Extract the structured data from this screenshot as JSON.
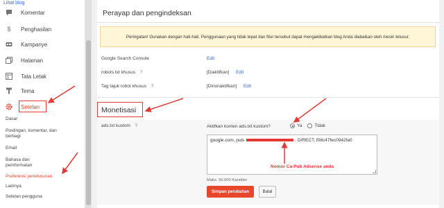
{
  "topbar": {
    "view_blog": "Lihat blog"
  },
  "sidebar": {
    "items": [
      {
        "label": "Komentar",
        "icon": "comment-icon"
      },
      {
        "label": "Penghasilan",
        "icon": "dollar-icon"
      },
      {
        "label": "Kampanye",
        "icon": "ad-icon"
      },
      {
        "label": "Halaman",
        "icon": "pages-icon"
      },
      {
        "label": "Tata Letak",
        "icon": "layout-icon"
      },
      {
        "label": "Tema",
        "icon": "brush-icon"
      },
      {
        "label": "Setelan",
        "icon": "gear-icon",
        "active": true
      }
    ],
    "subitems": [
      {
        "label": "Dasar"
      },
      {
        "label": "Postingan, komentar, dan berbagi"
      },
      {
        "label": "Email"
      },
      {
        "label": "Bahasa dan pemformatan"
      },
      {
        "label": "Preferensi penelusuran",
        "active": true
      },
      {
        "label": "Lainnya"
      },
      {
        "label": "Setelan pengguna"
      }
    ]
  },
  "main": {
    "section_title": "Perayap dan pengindeksan",
    "warning": "Peringatan! Gunakan dengan hati-hati. Penggunaan yang tidak tepat dan fitur tersebut dapat mengakibatkan blog Anda diabaikan oleh mesin telusur.",
    "rows": [
      {
        "label": "Google Search Console",
        "value": "",
        "edit": "Edit"
      },
      {
        "label": "robots.txt khusus",
        "help": "?",
        "value": "[Diaktifkan]",
        "edit": "Edit"
      },
      {
        "label": "Tag tajuk robot khusus",
        "help": "?",
        "value": "[Dinonaktifkan]",
        "edit": "Edit"
      }
    ],
    "monetization": {
      "title": "Monetisasi",
      "ads_label": "ads.txt kustom",
      "ads_help": "?",
      "enable_label": "Aktifkan konten ads.txt kustom?",
      "options": [
        "Ya",
        "Tidak"
      ],
      "selected": "Ya",
      "textarea_before": "google.com, pub-",
      "textarea_after": ", DIRECT, f08c47fec0942fa0",
      "max_chars": "Maks. 50.000 Karakter",
      "save_label": "Simpan perubahan",
      "cancel_label": "Batal",
      "annotation": "Nomor Ca-Pub Adsense anda"
    }
  },
  "colors": {
    "accent": "#e8472b",
    "annotation": "#e53935",
    "link": "#3367d6"
  }
}
